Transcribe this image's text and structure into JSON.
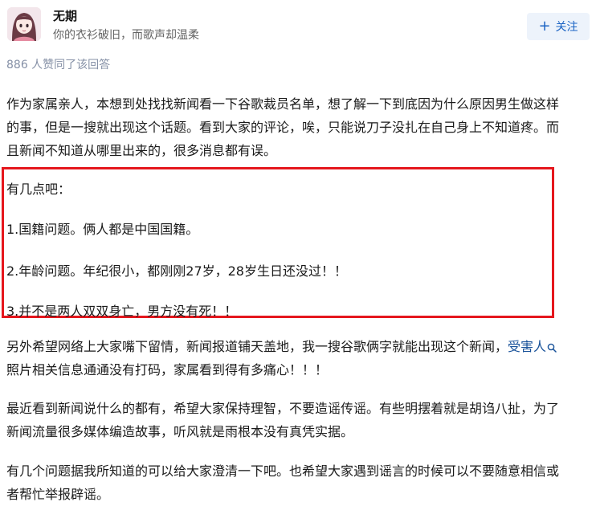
{
  "author": {
    "name": "无期",
    "bio": "你的衣衫破旧，而歌声却温柔"
  },
  "follow_button": {
    "label": "关注",
    "icon": "plus-icon"
  },
  "upvote_summary": "886 人赞同了该回答",
  "answer": {
    "paragraph1": [
      "作为家属亲人，本想到处找找新闻看一下谷歌裁员名单，想了解一下到底因为什么原因男生做这样",
      "的事，但是一搜就出现这个话题。看到大家的评论，唉，只能说刀子没扎在自己身上不知道疼。而",
      "且新闻不知道从哪里出来的，很多消息都有误。"
    ],
    "highlighted_points": [
      "有几点吧：",
      "1.国籍问题。俩人都是中国国籍。",
      "2.年龄问题。年纪很小，都刚刚27岁，28岁生日还没过！！",
      "3.并不是两人双双身亡，男方没有死！！"
    ],
    "paragraph2": {
      "line1_before": "另外希望网络上大家嘴下留情，新闻报道铺天盖地，我一搜谷歌俩字就能出现这个新闻，",
      "line1_link": "受害人",
      "line2": "照片相关信息通通没有打码，家属看到得有多痛心！！！"
    },
    "paragraph3": [
      "最近看到新闻说什么的都有，希望大家保持理智，不要造谣传谣。有些明摆着就是胡诌八扯，为了",
      "新闻流量很多媒体编造故事，听风就是雨根本没有真凭实据。"
    ],
    "paragraph4": [
      "有几个问题据我所知道的可以给大家澄清一下吧。也希望大家遇到谣言的时候可以不要随意相信或",
      "者帮忙举报辟谣。"
    ]
  },
  "colors": {
    "highlight_border": "#e5171d",
    "link": "#175199",
    "follow_bg": "#edf3fb",
    "follow_text": "#1c64c4"
  }
}
